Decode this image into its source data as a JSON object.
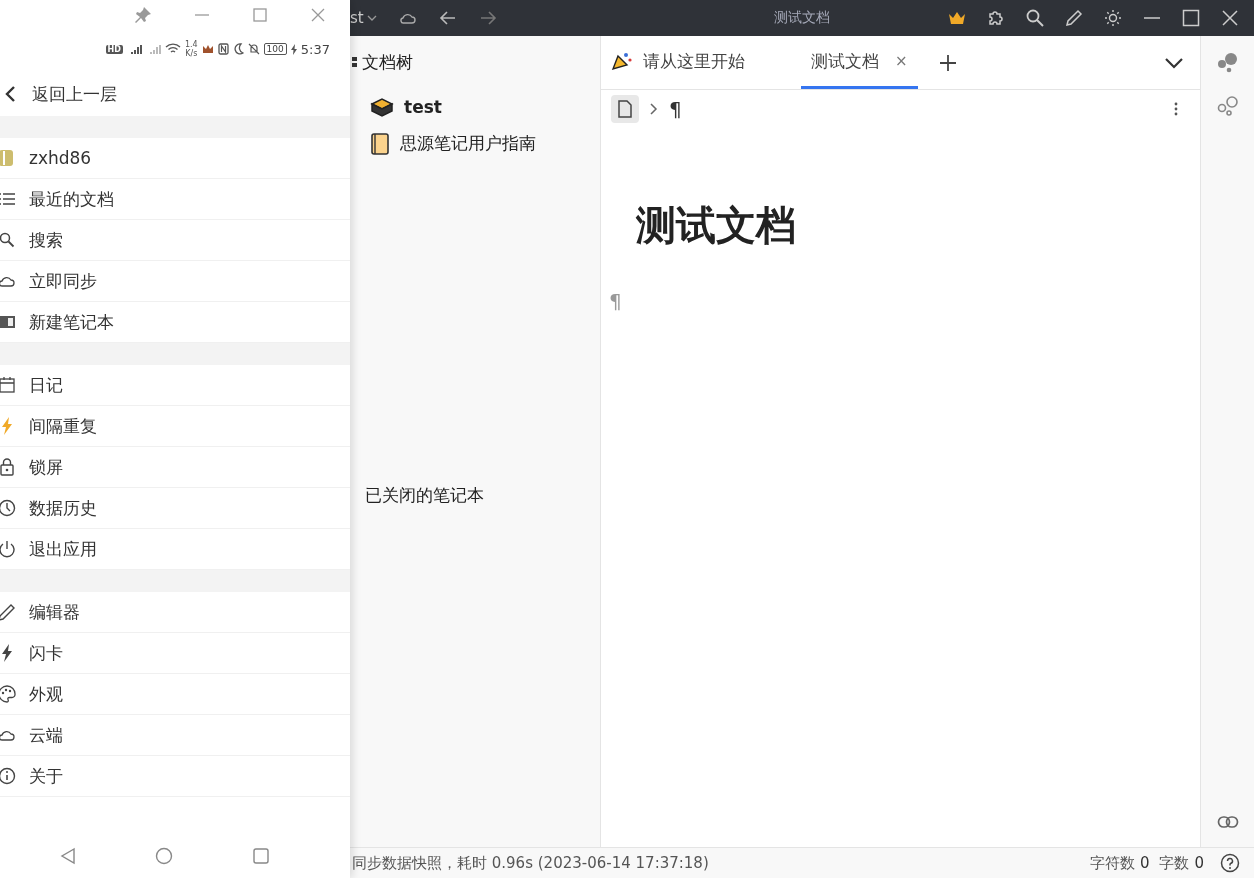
{
  "phone": {
    "status_bar": {
      "hd": "HD",
      "speed": "1.4",
      "speed_unit": "K/s",
      "battery": "100",
      "time": "5:37"
    },
    "back": {
      "label": "返回上一层"
    },
    "sections": [
      [
        {
          "label": "zxhd86"
        },
        {
          "label": "最近的文档"
        },
        {
          "label": "搜索"
        },
        {
          "label": "立即同步"
        },
        {
          "label": "新建笔记本"
        }
      ],
      [
        {
          "label": "日记"
        },
        {
          "label": "间隔重复"
        },
        {
          "label": "锁屏"
        },
        {
          "label": "数据历史"
        },
        {
          "label": "退出应用"
        }
      ],
      [
        {
          "label": "编辑器"
        },
        {
          "label": "闪卡"
        },
        {
          "label": "外观"
        },
        {
          "label": "云端"
        },
        {
          "label": "关于"
        }
      ]
    ]
  },
  "window": {
    "workspace": "st",
    "title": "测试文档"
  },
  "file_tree": {
    "title": "文档树",
    "notebooks": [
      {
        "label": "test",
        "bold": true
      },
      {
        "label": "思源笔记用户指南",
        "bold": false
      }
    ],
    "closed_label": "已关闭的笔记本"
  },
  "tabs": [
    {
      "label": "请从这里开始",
      "selected": false,
      "closable": false
    },
    {
      "label": "测试文档",
      "selected": true,
      "closable": true
    }
  ],
  "tab_close": "×",
  "breadcrumb": {
    "paragraph": "¶"
  },
  "document": {
    "title": "测试文档",
    "paragraph_mark": "¶"
  },
  "status_bar": {
    "message": "同步数据快照，耗时 0.96s (2023-06-14 17:37:18)",
    "char_label": "字符数",
    "char_count": "0",
    "word_label": "字数",
    "word_count": "0"
  }
}
